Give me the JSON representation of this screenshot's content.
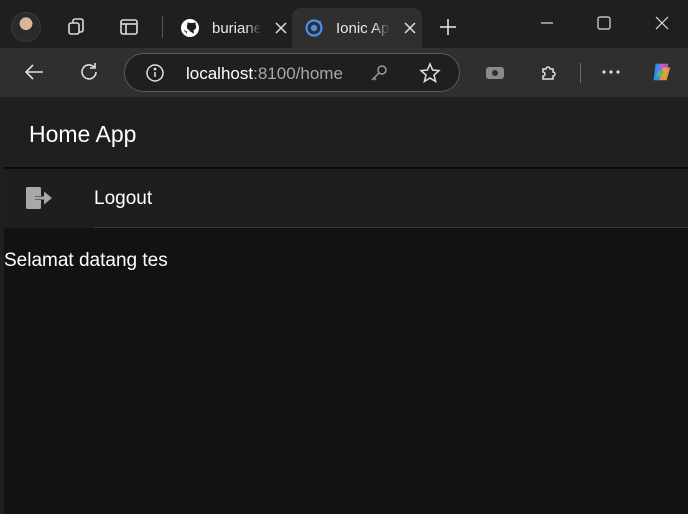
{
  "browser": {
    "tabs": [
      {
        "title": "buriane/",
        "favicon": "github-icon"
      },
      {
        "title": "Ionic App",
        "favicon": "ionic-icon"
      }
    ],
    "address": {
      "host": "localhost",
      "path": ":8100/home"
    }
  },
  "app": {
    "header_title": "Home App",
    "menu_item_label": "Logout",
    "menu_item_icon": "logout-icon",
    "welcome_text": "Selamat datang tes"
  },
  "colors": {
    "page_background": "#121212",
    "header_background": "#1f1f1f",
    "text": "#ffffff",
    "accent": "#4a8ef0"
  }
}
